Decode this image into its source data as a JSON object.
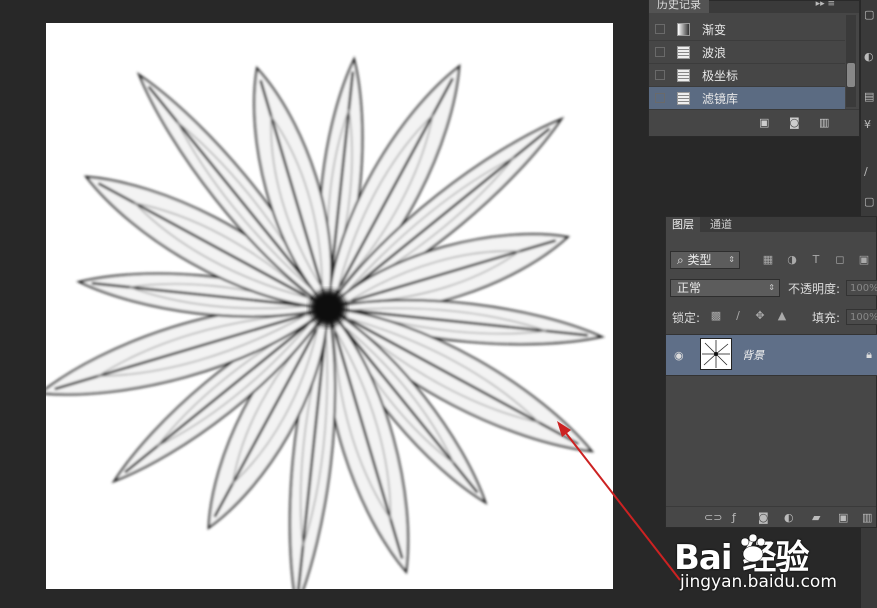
{
  "history": {
    "title": "历史记录",
    "items": [
      {
        "label": "渐变",
        "icon": "gradient-icon"
      },
      {
        "label": "波浪",
        "icon": "document-icon"
      },
      {
        "label": "极坐标",
        "icon": "document-icon"
      },
      {
        "label": "滤镜库",
        "icon": "document-icon",
        "selected": true
      }
    ]
  },
  "layers": {
    "tab_active": "图层",
    "tab_inactive": "通道",
    "filter_kind": "类型",
    "blend_mode": "正常",
    "opacity_label": "不透明度:",
    "opacity_value": "100%",
    "lock_label": "锁定:",
    "fill_label": "填充:",
    "fill_value": "100%",
    "layer_name": "背景"
  },
  "watermark": {
    "logo": "Bai  经验",
    "url": "jingyan.baidu.com"
  },
  "colors": {
    "selection": "#5b6b82",
    "annotation_arrow": "#cc2222"
  }
}
